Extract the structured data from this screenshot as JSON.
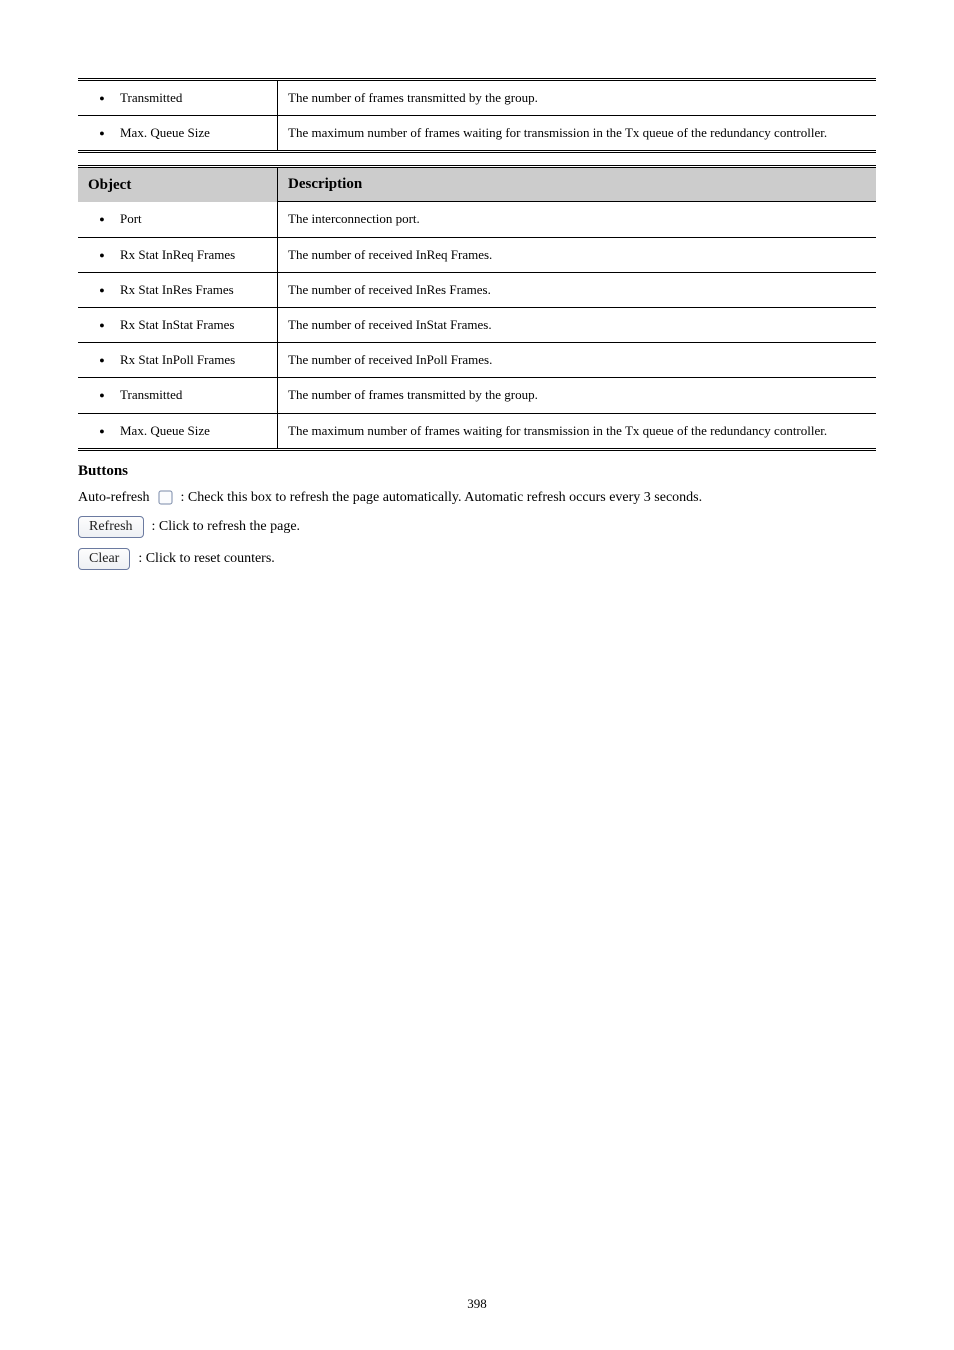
{
  "table1": {
    "rows": [
      {
        "label": "Transmitted",
        "desc": "The number of frames transmitted by the group."
      },
      {
        "label": "Max. Queue Size",
        "desc": "The maximum number of frames waiting for transmission in the Tx queue of the redundancy controller."
      }
    ]
  },
  "table2": {
    "header": {
      "left": "Object",
      "right": "Description"
    },
    "rows": [
      {
        "label": "Port",
        "desc": "The interconnection port."
      },
      {
        "label": "Rx Stat InReq Frames",
        "desc": "The number of received InReq Frames."
      },
      {
        "label": "Rx Stat InRes Frames",
        "desc": "The number of received InRes Frames."
      },
      {
        "label": "Rx Stat InStat Frames",
        "desc": "The number of received InStat Frames."
      },
      {
        "label": "Rx Stat InPoll Frames",
        "desc": "The number of received InPoll Frames."
      },
      {
        "label": "Transmitted",
        "desc": "The number of frames transmitted by the group."
      },
      {
        "label": "Max. Queue Size",
        "desc": "The maximum number of frames waiting for transmission in the Tx queue of the redundancy controller."
      }
    ]
  },
  "buttons": {
    "heading": "Buttons",
    "autorefresh": "Auto-refresh  : Check this box to refresh the page automatically. Automatic refresh occurs every 3 seconds.",
    "refresh_label": "Refresh",
    "refresh_desc": " : Click to refresh the page.",
    "clear_label": "Clear",
    "clear_desc": " : Click to reset counters."
  },
  "page": "398"
}
